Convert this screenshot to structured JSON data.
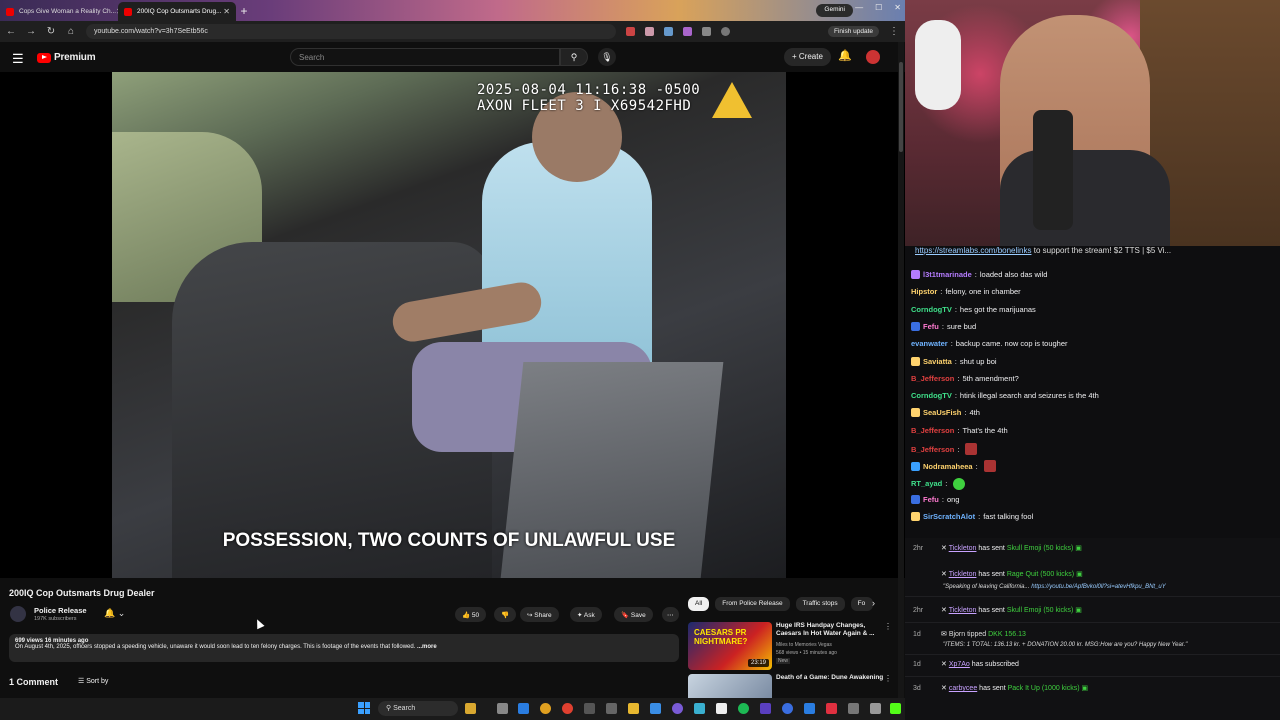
{
  "browser": {
    "tabs": [
      {
        "label": "Cops Give Woman a Reality Ch..."
      },
      {
        "label": "200IQ Cop Outsmarts Drug..."
      }
    ],
    "gemini_label": "Gemini",
    "url": "youtube.com/watch?v=3h7SeEtb56c",
    "finish_update": "Finish update"
  },
  "youtube": {
    "logo_text": "Premium",
    "search_placeholder": "Search",
    "create_label": "Create",
    "video": {
      "timestamp_line1": "2025-08-04 11:16:38 -0500",
      "timestamp_line2": "AXON FLEET 3 I X69542FHD",
      "subtitle": "POSSESSION, TWO COUNTS OF UNLAWFUL USE"
    },
    "title": "200IQ Cop Outsmarts Drug Dealer",
    "channel": {
      "name": "Police Release",
      "subscribers": "197K subscribers"
    },
    "actions": {
      "likes": "50",
      "share": "Share",
      "ask": "Ask",
      "save": "Save"
    },
    "description": {
      "meta": "699 views  16 minutes ago",
      "text": "On August 4th, 2025, officers stopped a speeding vehicle, unaware it would soon lead to ten felony charges. This is footage of the events that followed.",
      "more": "...more"
    },
    "comments_count": "1 Comment",
    "sort_label": "Sort by",
    "chips": [
      "All",
      "From Police Release",
      "Traffic stops",
      "Fo"
    ],
    "recommendations": [
      {
        "title": "Huge IRS Handpay Changes, Caesars In Hot Water Again & ...",
        "channel": "Miles to Memories Vegas",
        "meta": "568 views • 15 minutes ago",
        "badge": "New",
        "duration": "23:19",
        "thumb_text": "CAESARS PR NIGHTMARE?"
      },
      {
        "title": "Death of a Game: Dune Awakening",
        "channel": "",
        "meta": "",
        "badge": "",
        "duration": "",
        "thumb_text": ""
      }
    ]
  },
  "stream": {
    "chat_link_url": "https://streamlabs.com/bonelinks",
    "chat_link_rest": " to support the stream! $2 TTS | $5 Vi...",
    "messages": [
      {
        "user": "l3t1tmarinade",
        "color": "#b57cff",
        "text": "loaded also das wild"
      },
      {
        "user": "Hipstor",
        "color": "#ffd36e",
        "text": "felony, one in chamber"
      },
      {
        "user": "CorndogTV",
        "color": "#3fe08a",
        "text": "hes got the marijuanas"
      },
      {
        "user": "Fefu",
        "color": "#ff7ad0",
        "text": "sure bud"
      },
      {
        "user": "evanwater",
        "color": "#6fb3ff",
        "text": "backup came. now cop is tougher"
      },
      {
        "user": "Saviatta",
        "color": "#ffd36e",
        "text": "shut up boi"
      },
      {
        "user": "B_Jefferson",
        "color": "#e04040",
        "text": "5th amendment?"
      },
      {
        "user": "CorndogTV",
        "color": "#3fe08a",
        "text": "htink illegal search and seizures is the 4th"
      },
      {
        "user": "SeaUsFish",
        "color": "#ffd36e",
        "text": "4th"
      },
      {
        "user": "B_Jefferson",
        "color": "#e04040",
        "text": "That's the 4th"
      },
      {
        "user": "B_Jefferson",
        "color": "#e04040",
        "text": ""
      },
      {
        "user": "Nodramaheea",
        "color": "#ffd36e",
        "text": ""
      },
      {
        "user": "RT_ayad",
        "color": "#3fe08a",
        "text": ""
      },
      {
        "user": "Fefu",
        "color": "#ff7ad0",
        "text": "ong"
      },
      {
        "user": "SirScratchAlot",
        "color": "#6fb3ff",
        "text": "fast talking fool"
      }
    ],
    "events": [
      {
        "time": "2hr",
        "user": "Tickleton",
        "action": "has sent",
        "gift": "Skull Emoji (50 kicks)"
      },
      {
        "time": "",
        "user": "Tickleton",
        "action": "has sent",
        "gift": "Rage Quit (500 kicks)"
      },
      {
        "time": "2hr",
        "user": "Tickleton",
        "action": "has sent",
        "gift": "Skull Emoji (50 kicks)"
      },
      {
        "time": "1d",
        "user": "Bjorn tipped",
        "action": "",
        "gift": "DKK 156.13"
      },
      {
        "time": "1d",
        "user": "Xp7Ao",
        "action": "has subscribed",
        "gift": ""
      },
      {
        "time": "3d",
        "user": "carbycee",
        "action": "has sent",
        "gift": "Pack It Up (1000 kicks)"
      }
    ],
    "event_notes": {
      "rage_quit": "\"Speaking of leaving California...",
      "rage_quit_link": "https://youtu.be/ApfBvkol0ll?si=atevHfkpu_BNt_uY",
      "bjorn": "\"ITEMS: 1 TOTAL: 136.13 kr. + DONATION 20.00 kr. MSG:How are you? Happy New Year.\""
    }
  },
  "taskbar": {
    "search_label": "Search"
  },
  "colors": {
    "youtube_red": "#ff0000",
    "kick_green": "#53fc18"
  }
}
